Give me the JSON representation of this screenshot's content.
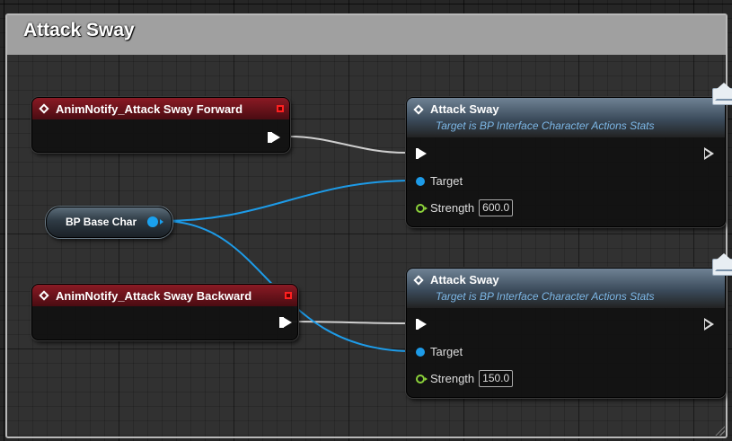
{
  "comment": {
    "title": "Attack Sway"
  },
  "event_nodes": [
    {
      "title": "AnimNotify_Attack Sway Forward"
    },
    {
      "title": "AnimNotify_Attack Sway Backward"
    }
  ],
  "variable_node": {
    "label": "BP Base Char"
  },
  "function_nodes": [
    {
      "title": "Attack Sway",
      "subtitle": "Target is BP Interface Character Actions Stats",
      "target_label": "Target",
      "strength_label": "Strength",
      "strength_value": "600.0"
    },
    {
      "title": "Attack Sway",
      "subtitle": "Target is BP Interface Character Actions Stats",
      "target_label": "Target",
      "strength_label": "Strength",
      "strength_value": "150.0"
    }
  ],
  "colors": {
    "event_header": "#8a1a24",
    "function_header": "#5a6e80",
    "object_pin": "#1d9be8",
    "float_pin": "#8bd13a",
    "exec_wire": "#cfcfcf",
    "comment_header": "#a0a0a0"
  }
}
